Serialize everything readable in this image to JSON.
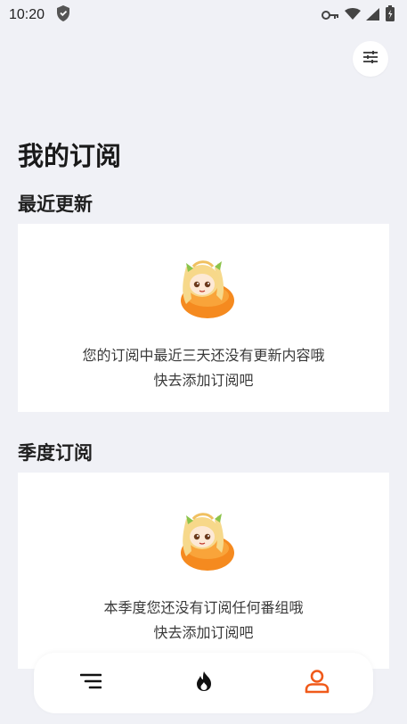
{
  "status_bar": {
    "time": "10:20",
    "icons": [
      "shield-icon",
      "key-icon",
      "wifi-icon",
      "signal-icon",
      "battery-icon"
    ]
  },
  "header": {
    "filter_icon": "tune-icon"
  },
  "page": {
    "title": "我的订阅"
  },
  "sections": {
    "recent": {
      "title": "最近更新",
      "empty_line1": "您的订阅中最近三天还没有更新内容哦",
      "empty_line2": "快去添加订阅吧"
    },
    "season": {
      "title": "季度订阅",
      "empty_line1": "本季度您还没有订阅任何番组哦",
      "empty_line2": "快去添加订阅吧"
    }
  },
  "bottom_nav": {
    "items": [
      {
        "icon": "list-menu-icon",
        "active": false
      },
      {
        "icon": "flame-icon",
        "active": false
      },
      {
        "icon": "user-icon",
        "active": true
      }
    ]
  },
  "colors": {
    "background": "#f0f1f6",
    "accent": "#f05a1a",
    "card": "#ffffff"
  }
}
